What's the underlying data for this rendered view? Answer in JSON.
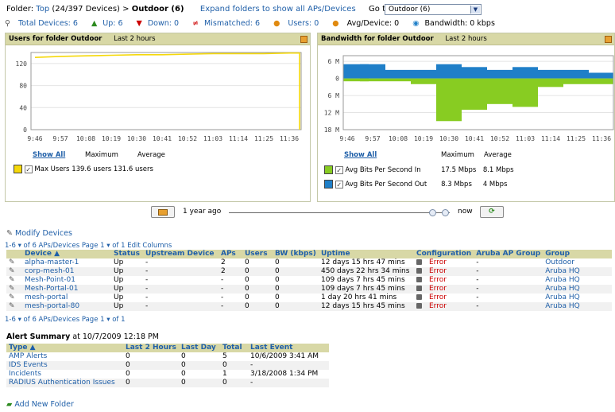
{
  "header": {
    "folder_label": "Folder:",
    "folder_top": "Top",
    "folder_count": "(24/397 Devices)",
    "separator": ">",
    "current_folder": "Outdoor (6)",
    "expand_link": "Expand folders to show all APs/Devices",
    "goto_label": "Go to folder:",
    "goto_value": "Outdoor (6)"
  },
  "stats": {
    "total_devices": "Total Devices: 6",
    "up": "Up: 6",
    "down": "Down: 0",
    "mismatched": "Mismatched: 6",
    "users": "Users: 0",
    "avg_device": "Avg/Device: 0",
    "bandwidth": "Bandwidth: 0 kbps"
  },
  "users_panel": {
    "title": "Users for folder Outdoor",
    "range": "Last 2 hours",
    "show_all": "Show All",
    "col_max": "Maximum",
    "col_avg": "Average",
    "legend": {
      "label": "Max Users",
      "max": "139.6 users",
      "avg": "131.6 users",
      "color": "#f5d80a"
    }
  },
  "bw_panel": {
    "title": "Bandwidth for folder Outdoor",
    "range": "Last 2 hours",
    "show_all": "Show All",
    "col_max": "Maximum",
    "col_avg": "Average",
    "legend": [
      {
        "label": "Avg Bits Per Second In",
        "max": "17.5 Mbps",
        "avg": "8.1 Mbps",
        "color": "#88cc22"
      },
      {
        "label": "Avg Bits Per Second Out",
        "max": "8.3 Mbps",
        "avg": "4 Mbps",
        "color": "#1f7fc8"
      }
    ]
  },
  "chart_data": [
    {
      "type": "line",
      "title": "Users for folder Outdoor",
      "x": [
        "9:46",
        "9:57",
        "10:08",
        "10:19",
        "10:30",
        "10:41",
        "10:52",
        "11:03",
        "11:14",
        "11:25",
        "11:36"
      ],
      "ylim": [
        0,
        140
      ],
      "yticks": [
        "120",
        "80",
        "40",
        "0"
      ],
      "series": [
        {
          "name": "Max Users",
          "values": [
            131,
            133,
            134,
            135,
            136,
            136,
            137,
            138,
            138,
            138,
            139
          ]
        }
      ]
    },
    {
      "type": "area",
      "title": "Bandwidth for folder Outdoor",
      "x": [
        "9:46",
        "9:57",
        "10:08",
        "10:19",
        "10:30",
        "10:41",
        "10:52",
        "11:03",
        "11:14",
        "11:25",
        "11:36"
      ],
      "ylim": [
        -18,
        8
      ],
      "yticks": [
        "6 M",
        "0",
        "6 M",
        "12 M",
        "18 M"
      ],
      "series": [
        {
          "name": "Avg Bits Per Second Out",
          "values": [
            5,
            5,
            3,
            3,
            5,
            4,
            3,
            4,
            3,
            3,
            2
          ]
        },
        {
          "name": "Avg Bits Per Second In",
          "values": [
            -1,
            -1,
            -1,
            -2,
            -15,
            -11,
            -9,
            -10,
            -3,
            -2,
            -2
          ]
        }
      ]
    }
  ],
  "time_slider": {
    "start_label": "1 year ago",
    "end_label": "now"
  },
  "devices": {
    "modify_link": "Modify Devices",
    "pager_top": "1-6 ▾ of 6 APs/Devices  Page 1 ▾ of 1",
    "edit_columns": "Edit Columns",
    "pager_bottom": "1-6 ▾ of 6 APs/Devices  Page 1 ▾ of 1",
    "columns": [
      "Device ▲",
      "Status",
      "Upstream Device",
      "APs",
      "Users",
      "BW (kbps)",
      "Uptime",
      "Configuration",
      "Aruba AP Group",
      "Group"
    ],
    "rows": [
      {
        "device": "alpha-master-1",
        "status": "Up",
        "upstream": "-",
        "aps": "2",
        "users": "0",
        "bw": "0",
        "uptime": "12 days 15 hrs 47 mins",
        "config": "Error",
        "group_ap": "-",
        "group": "Outdoor"
      },
      {
        "device": "corp-mesh-01",
        "status": "Up",
        "upstream": "-",
        "aps": "2",
        "users": "0",
        "bw": "0",
        "uptime": "450 days 22 hrs 34 mins",
        "config": "Error",
        "group_ap": "-",
        "group": "Aruba HQ"
      },
      {
        "device": "Mesh-Point-01",
        "status": "Up",
        "upstream": "-",
        "aps": "-",
        "users": "0",
        "bw": "0",
        "uptime": "109 days 7 hrs 45 mins",
        "config": "Error",
        "group_ap": "-",
        "group": "Aruba HQ"
      },
      {
        "device": "Mesh-Portal-01",
        "status": "Up",
        "upstream": "-",
        "aps": "-",
        "users": "0",
        "bw": "0",
        "uptime": "109 days 7 hrs 45 mins",
        "config": "Error",
        "group_ap": "-",
        "group": "Aruba HQ"
      },
      {
        "device": "mesh-portal",
        "status": "Up",
        "upstream": "-",
        "aps": "-",
        "users": "0",
        "bw": "0",
        "uptime": "1 day 20 hrs 41 mins",
        "config": "Error",
        "group_ap": "-",
        "group": "Aruba HQ"
      },
      {
        "device": "mesh-portal-80",
        "status": "Up",
        "upstream": "-",
        "aps": "-",
        "users": "0",
        "bw": "0",
        "uptime": "12 days 15 hrs 45 mins",
        "config": "Error",
        "group_ap": "-",
        "group": "Aruba HQ"
      }
    ]
  },
  "alerts": {
    "title": "Alert Summary",
    "timestamp": "at 10/7/2009 12:18 PM",
    "columns": [
      "Type ▲",
      "Last 2 Hours",
      "Last Day",
      "Total",
      "Last Event"
    ],
    "rows": [
      {
        "type": "AMP Alerts",
        "last2": "0",
        "lastday": "0",
        "total": "5",
        "last_event": "10/6/2009 3:41 AM"
      },
      {
        "type": "IDS Events",
        "last2": "0",
        "lastday": "0",
        "total": "0",
        "last_event": "-"
      },
      {
        "type": "Incidents",
        "last2": "0",
        "lastday": "0",
        "total": "1",
        "last_event": "3/18/2008 1:34 PM"
      },
      {
        "type": "RADIUS Authentication Issues",
        "last2": "0",
        "lastday": "0",
        "total": "0",
        "last_event": "-"
      }
    ]
  },
  "add_folder": "Add New Folder"
}
